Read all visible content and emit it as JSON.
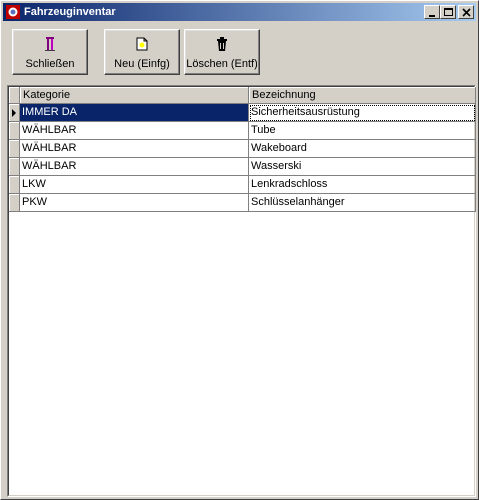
{
  "window": {
    "title": "Fahrzeuginventar",
    "controls": {
      "minimize": "minimize-icon",
      "maximize": "maximize-icon",
      "close": "close-icon"
    }
  },
  "toolbar": {
    "close_label": "Schließen",
    "new_label": "Neu (Einfg)",
    "delete_label": "Löschen (Entf)"
  },
  "grid": {
    "columns": [
      "Kategorie",
      "Bezeichnung"
    ],
    "rows": [
      {
        "kategorie": "IMMER DA",
        "bezeichnung": "Sicherheitsausrüstung",
        "selected": true
      },
      {
        "kategorie": "WÄHLBAR",
        "bezeichnung": "Tube"
      },
      {
        "kategorie": "WÄHLBAR",
        "bezeichnung": "Wakeboard"
      },
      {
        "kategorie": "WÄHLBAR",
        "bezeichnung": "Wasserski"
      },
      {
        "kategorie": "LKW",
        "bezeichnung": "Lenkradschloss"
      },
      {
        "kategorie": "PKW",
        "bezeichnung": "Schlüsselanhänger"
      }
    ]
  },
  "colors": {
    "titlebar_start": "#0a246a",
    "titlebar_end": "#a6caf0",
    "selection": "#0a246a",
    "face": "#d4d0c8"
  }
}
